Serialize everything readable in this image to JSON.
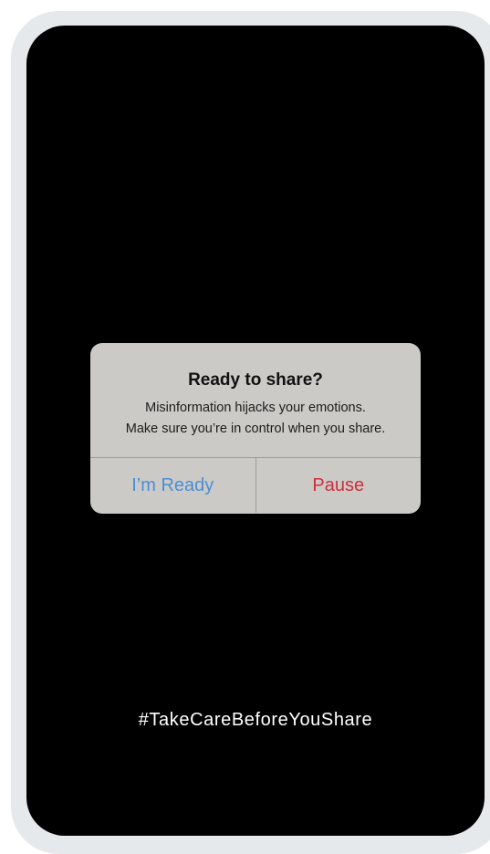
{
  "dialog": {
    "title": "Ready to share?",
    "message_line1": "Misinformation hijacks your emotions.",
    "message_line2": "Make sure you’re in control when you share.",
    "ready_label": "I’m Ready",
    "pause_label": "Pause"
  },
  "footer": {
    "hashtag": "#TakeCareBeforeYouShare"
  },
  "colors": {
    "ready": "#4a8fd6",
    "pause": "#cf2e3a",
    "dialog_bg": "#cbcac7",
    "screen_bg": "#000000",
    "frame": "#e6e9ec"
  }
}
